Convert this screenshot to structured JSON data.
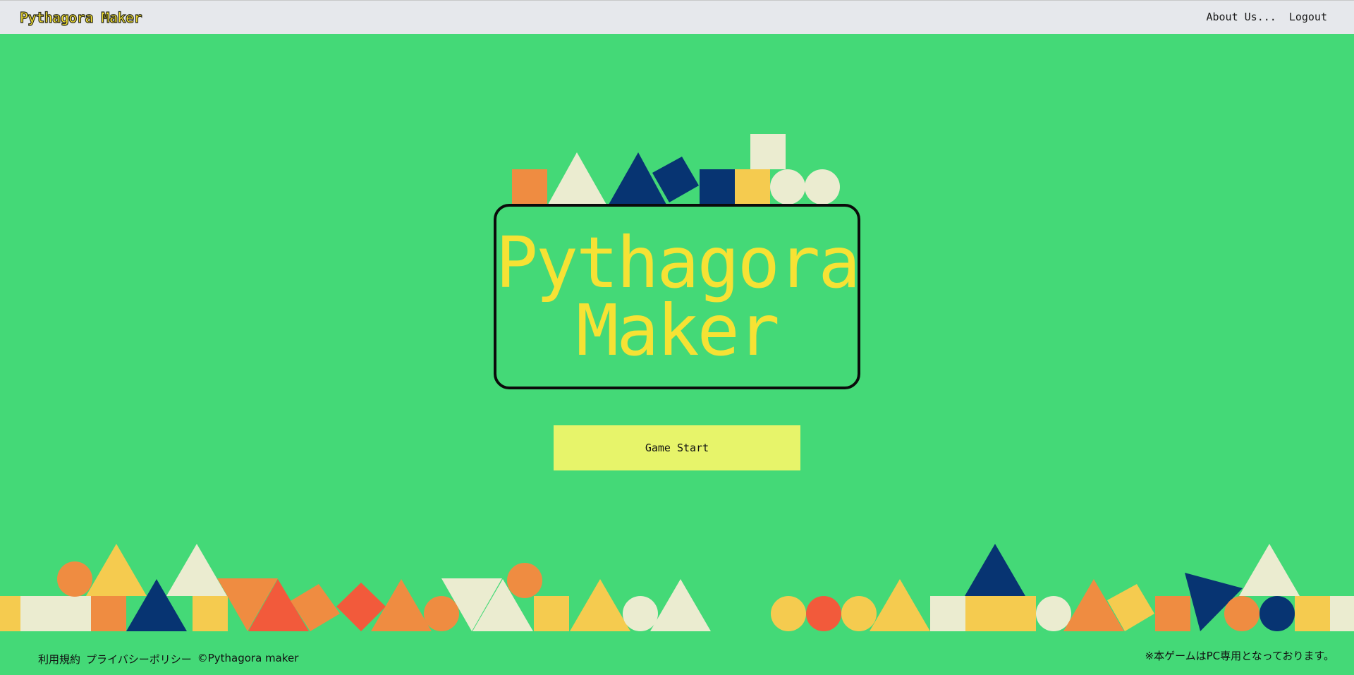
{
  "header": {
    "brand": "Pythagora Maker",
    "nav": {
      "about": "About Us...",
      "logout": "Logout"
    }
  },
  "main": {
    "title_line1": "Pythagora",
    "title_line2": "Maker",
    "start_button": "Game Start"
  },
  "footer": {
    "terms": "利用規約",
    "privacy": "プライバシーポリシー",
    "copyright": "©Pythagora maker",
    "notice": "※本ゲームはPC専用となっております。"
  },
  "colors": {
    "background": "#44d977",
    "header": "#e6e8ec",
    "title_yellow": "#f6e234",
    "button": "#e7f46a",
    "block_orange": "#ef8c41",
    "block_cream": "#ebecd0",
    "block_navy": "#073472",
    "block_yellow": "#f5cb4f",
    "block_red": "#f25a3b"
  }
}
